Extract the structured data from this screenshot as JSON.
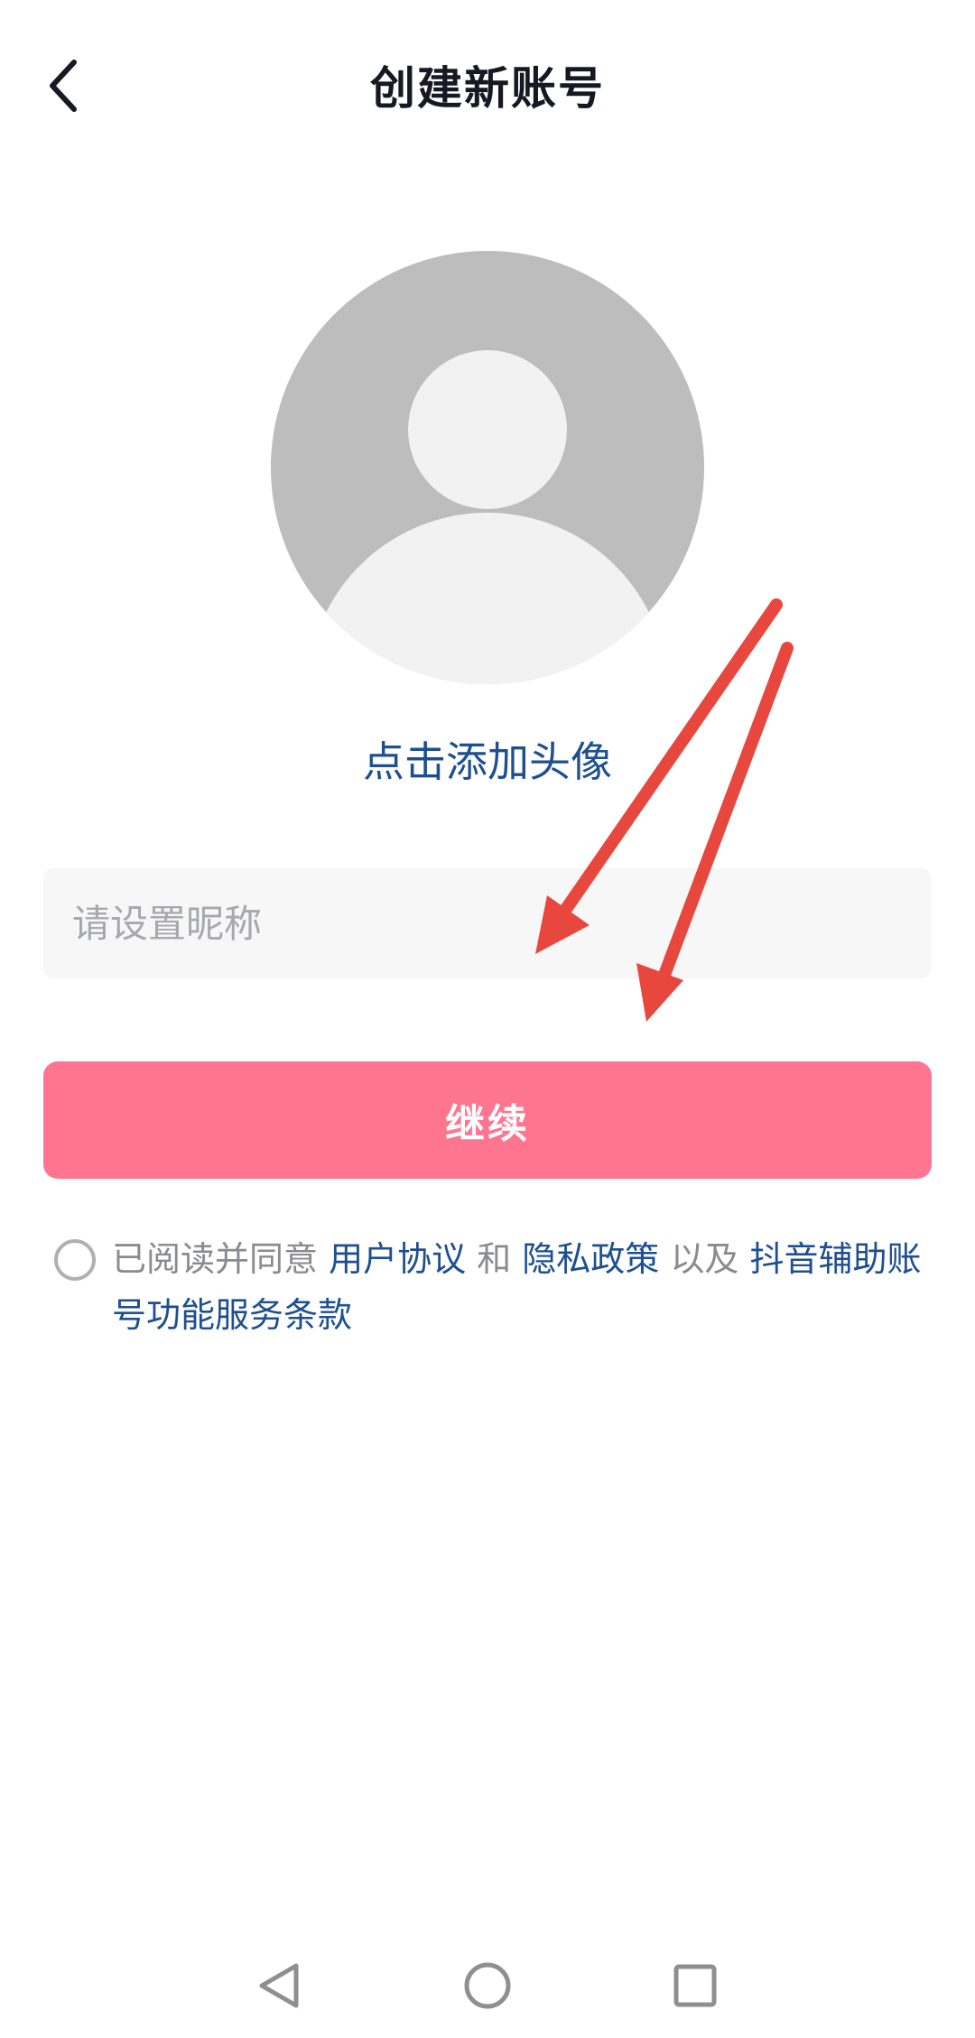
{
  "header": {
    "title": "创建新账号",
    "back_icon": "chevron-left-icon"
  },
  "avatar": {
    "icon": "default-avatar-icon",
    "add_label": "点击添加头像",
    "bg_color": "#bdbdbd",
    "figure_color": "#f2f2f2"
  },
  "nickname": {
    "placeholder": "请设置昵称",
    "value": ""
  },
  "continue_button": {
    "label": "继续",
    "color": "#fe758f"
  },
  "agreement": {
    "checked": false,
    "prefix": "已阅读并同意 ",
    "user_agreement": "用户协议",
    "and": " 和 ",
    "privacy_policy": "隐私政策",
    "as_well_as": " 以及 ",
    "assist_terms": "抖音辅助账号功能服务条款",
    "link_color": "#1d4f91"
  },
  "annotation": {
    "arrow_color": "#e8473d"
  },
  "nav_bar": {
    "back_icon": "nav-back-triangle-icon",
    "home_icon": "nav-home-circle-icon",
    "recents_icon": "nav-recents-square-icon"
  }
}
